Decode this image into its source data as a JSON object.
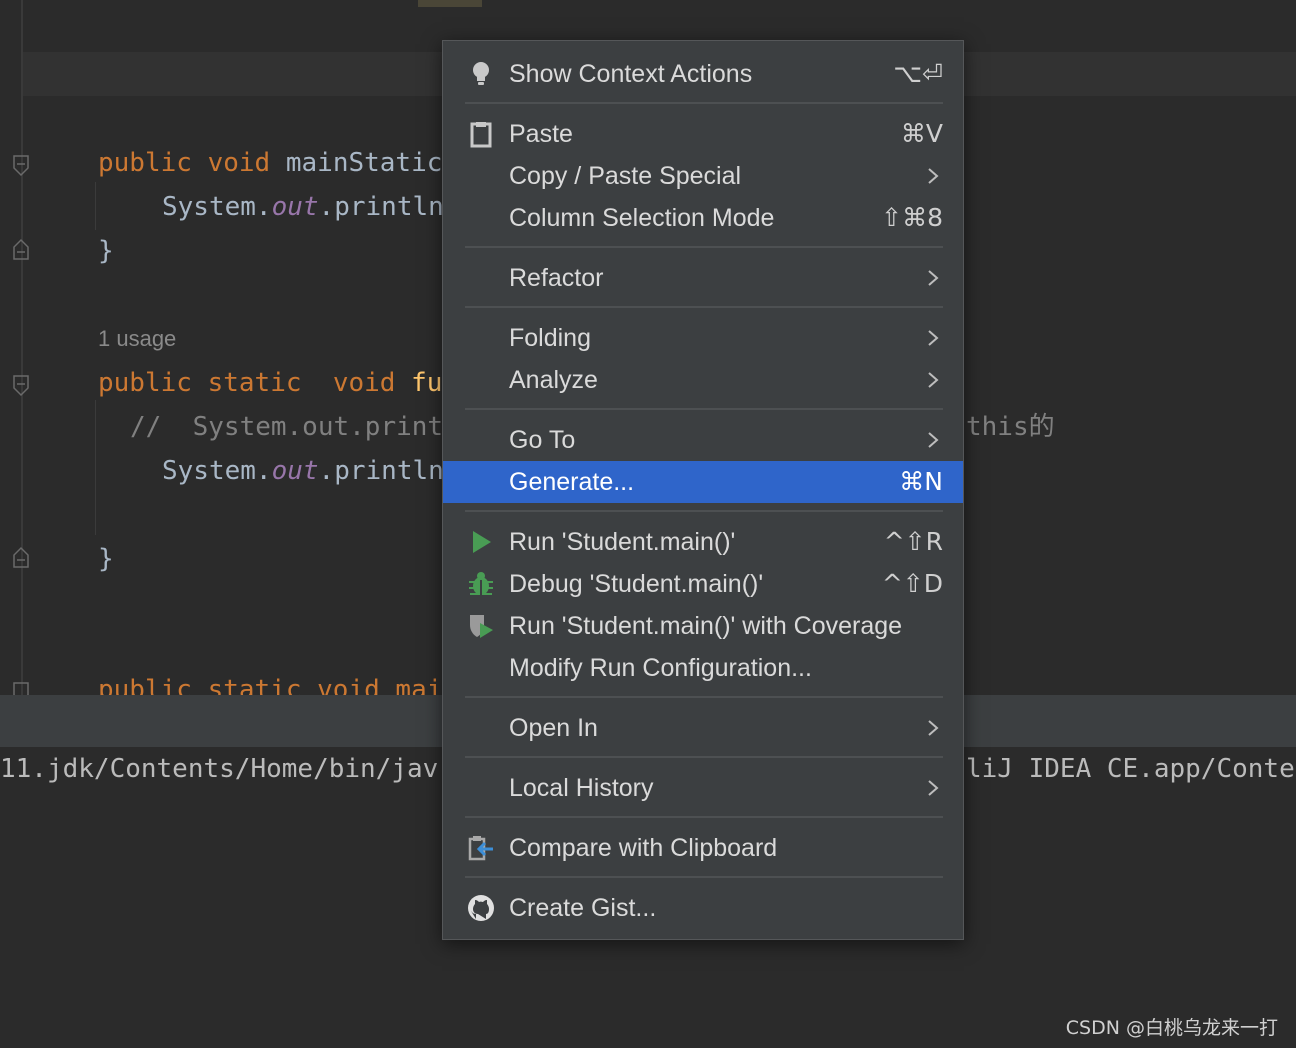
{
  "editor": {
    "line1": {
      "kw1": "public",
      "kw2": "void",
      "name": "mainStatic"
    },
    "line2": {
      "obj": "System.",
      "field": "out",
      "call": ".println"
    },
    "close_brace": "}",
    "usage_hint": "1 usage",
    "line5": {
      "kw1": "public",
      "kw2": "static",
      "kw3": "void",
      "name": "fu"
    },
    "line6": {
      "comment": "//  System.out.print",
      "tail": "this的"
    },
    "line7": {
      "obj": "System.",
      "field": "out",
      "call": ".println"
    },
    "line9": {
      "partial": "public static void mai"
    }
  },
  "console": {
    "left_text": "11.jdk/Contents/Home/bin/jav",
    "right_text": "liJ IDEA CE.app/Conte"
  },
  "menu": {
    "items": [
      {
        "label": "Show Context Actions",
        "shortcut": "⌥⏎",
        "icon": "lightbulb-icon"
      },
      {
        "label": "Paste",
        "shortcut": "⌘V",
        "icon": "clipboard-icon"
      },
      {
        "label": "Copy / Paste Special",
        "submenu": true
      },
      {
        "label": "Column Selection Mode",
        "shortcut": "⇧⌘8"
      },
      {
        "label": "Refactor",
        "submenu": true
      },
      {
        "label": "Folding",
        "submenu": true
      },
      {
        "label": "Analyze",
        "submenu": true
      },
      {
        "label": "Go To",
        "submenu": true
      },
      {
        "label": "Generate...",
        "shortcut": "⌘N",
        "selected": true
      },
      {
        "label": "Run 'Student.main()'",
        "shortcut": "^⇧R",
        "icon": "run-icon"
      },
      {
        "label": "Debug 'Student.main()'",
        "shortcut": "^⇧D",
        "icon": "debug-bug-icon"
      },
      {
        "label": "Run 'Student.main()' with Coverage",
        "icon": "coverage-icon"
      },
      {
        "label": "Modify Run Configuration..."
      },
      {
        "label": "Open In",
        "submenu": true
      },
      {
        "label": "Local History",
        "submenu": true
      },
      {
        "label": "Compare with Clipboard",
        "icon": "compare-clipboard-icon"
      },
      {
        "label": "Create Gist...",
        "icon": "github-icon"
      }
    ]
  },
  "watermark": "CSDN @白桃乌龙来一打",
  "colors": {
    "menu_bg": "#3c3f41",
    "selection": "#2f65ca",
    "keyword": "#cc7832",
    "function": "#ffc66d",
    "static_field": "#9876aa",
    "run_green": "#499c54"
  }
}
